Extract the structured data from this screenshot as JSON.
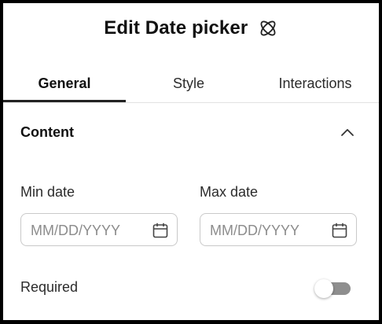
{
  "header": {
    "title": "Edit Date picker",
    "icon": "atom-icon"
  },
  "tabs": [
    {
      "label": "General",
      "active": true
    },
    {
      "label": "Style",
      "active": false
    },
    {
      "label": "Interactions",
      "active": false
    }
  ],
  "content_section": {
    "title": "Content",
    "expanded": true,
    "icon": "chevron-up-icon"
  },
  "min_date": {
    "label": "Min date",
    "placeholder": "MM/DD/YYYY",
    "value": "",
    "icon": "calendar-icon"
  },
  "max_date": {
    "label": "Max date",
    "placeholder": "MM/DD/YYYY",
    "value": "",
    "icon": "calendar-icon"
  },
  "required": {
    "label": "Required",
    "enabled": false
  },
  "colors": {
    "text": "#1a1a1a",
    "tab_underline": "#222222",
    "toggle_track_off": "#8e8e8e",
    "border": "#c9c9c9"
  }
}
